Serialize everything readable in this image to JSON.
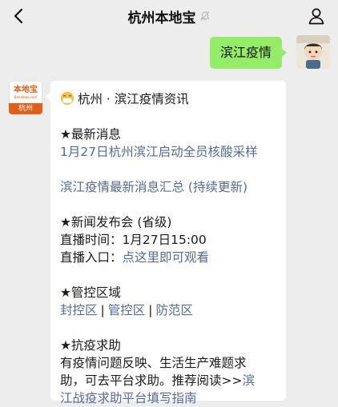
{
  "nav": {
    "title": "杭州本地宝"
  },
  "outgoing": {
    "text": "滨江疫情"
  },
  "account_avatar": {
    "logo_text": "本地宝",
    "logo_sub": "Bendibao.com",
    "city": "杭州"
  },
  "message": {
    "header": "杭州 · 滨江疫情资讯",
    "sec1_title": "★最新消息",
    "sec1_link1": "1月27日杭州滨江启动全员核酸采样",
    "sec1_link2": "滨江疫情最新消息汇总 (持续更新)",
    "sec2_title": "★新闻发布会 (省级)",
    "sec2_time_label": "直播时间：",
    "sec2_time_value": "1月27日15:00",
    "sec2_entry_label": "直播入口：",
    "sec2_entry_link": "点这里即可观看",
    "sec3_title": "★管控区域",
    "sec3_zones": [
      "封控区",
      "管控区",
      "防范区"
    ],
    "sec3_sep": "|",
    "sec4_title": "★抗疫求助",
    "sec4_line1": "有疫情问题反映、生活生产难题求",
    "sec4_line2_text": "助，可去平台求助。推荐阅读>>",
    "sec4_line2_link": "滨",
    "sec4_line3_link": "江战疫求助平台填写指南"
  },
  "colors": {
    "bubble_out": "#95ec69",
    "link": "#576b95",
    "brand": "#e0601a"
  },
  "icons": [
    "back-arrow-icon",
    "mute-bell-icon",
    "contact-icon",
    "mask-face-emoji"
  ]
}
